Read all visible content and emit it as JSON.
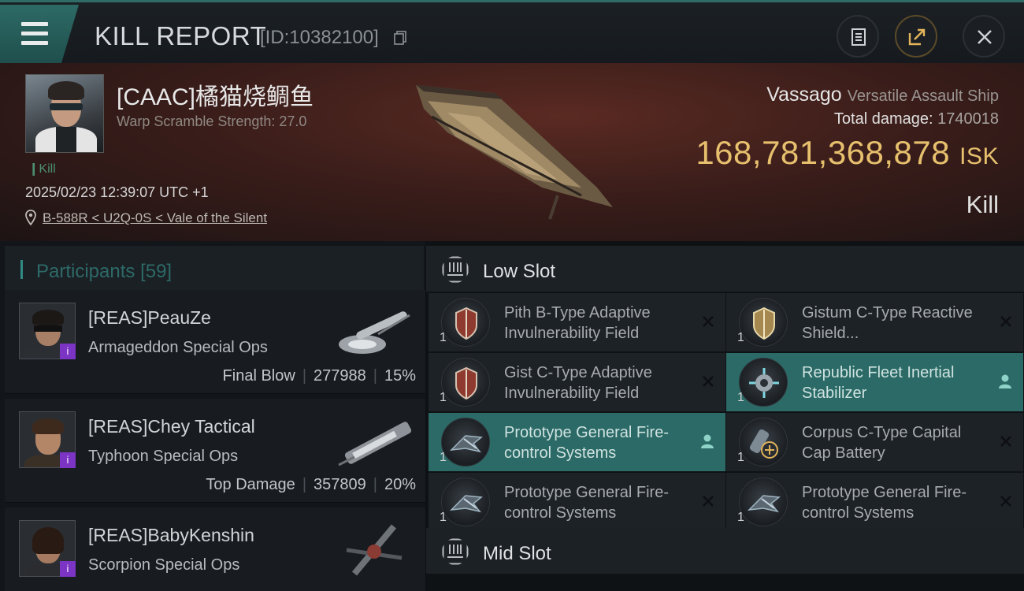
{
  "topbar": {
    "title": "KILL REPORT",
    "report_id": "[ID:10382100]"
  },
  "victim": {
    "name": "[CAAC]橘猫烧鲷鱼",
    "warp_scramble": "Warp Scramble Strength: 27.0",
    "kill_tag": "Kill",
    "datetime": "2025/02/23 12:39:07 UTC +1",
    "location": "B-588R < U2Q-0S < Vale of the Silent",
    "ship_name": "Vassago",
    "ship_type": "Versatile Assault Ship",
    "total_damage_label": "Total damage:",
    "total_damage": "1740018",
    "isk_value": "168,781,368,878",
    "isk_unit": "ISK",
    "result": "Kill"
  },
  "participants": {
    "label": "Participants",
    "count": "[59]",
    "rows": [
      {
        "name": "[REAS]PeauZe",
        "ship": "Armageddon Special Ops",
        "role": "Final Blow",
        "damage": "277988",
        "percent": "15%",
        "badge": "i"
      },
      {
        "name": "[REAS]Chey Tactical",
        "ship": "Typhoon Special Ops",
        "role": "Top Damage",
        "damage": "357809",
        "percent": "20%",
        "badge": "i"
      },
      {
        "name": "[REAS]BabyKenshin",
        "ship": "Scorpion Special Ops",
        "badge": "i"
      }
    ]
  },
  "slots": {
    "low_slot_label": "Low Slot",
    "mid_slot_label": "Mid Slot",
    "low_modules": [
      {
        "name": "Pith B-Type Adaptive Invulnerability Field",
        "qty": "1",
        "state": "destroyed",
        "icon": "shield-icon"
      },
      {
        "name": "Gistum C-Type Reactive Shield...",
        "qty": "1",
        "state": "destroyed",
        "icon": "shield-gold-icon"
      },
      {
        "name": "Gist C-Type Adaptive Invulnerability Field",
        "qty": "1",
        "state": "destroyed",
        "icon": "shield-icon"
      },
      {
        "name": "Republic Fleet Inertial Stabilizer",
        "qty": "1",
        "state": "dropped",
        "icon": "stabilizer-icon"
      },
      {
        "name": "Prototype General Fire-control Systems",
        "qty": "1",
        "state": "dropped",
        "icon": "fire-control-icon"
      },
      {
        "name": "Corpus C-Type Capital Cap Battery",
        "qty": "1",
        "state": "destroyed",
        "icon": "cap-battery-icon"
      },
      {
        "name": "Prototype General Fire-control Systems",
        "qty": "1",
        "state": "destroyed",
        "icon": "fire-control-icon"
      },
      {
        "name": "Prototype General Fire-control Systems",
        "qty": "1",
        "state": "destroyed",
        "icon": "fire-control-icon"
      }
    ]
  },
  "colors": {
    "accent_teal": "#2b6a66",
    "isk_gold": "#e7c06e",
    "badge_purple": "#7b34c4"
  }
}
